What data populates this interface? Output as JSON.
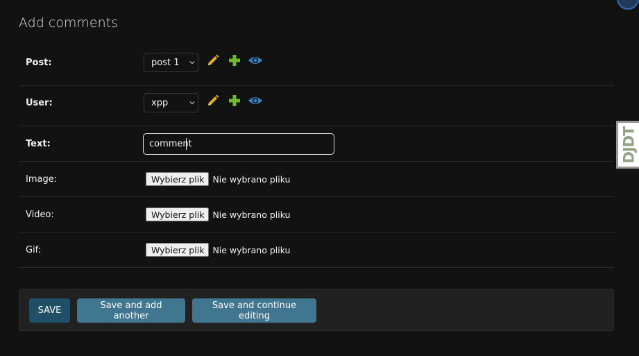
{
  "page": {
    "title": "Add comments"
  },
  "fields": {
    "post": {
      "label": "Post:",
      "selected": "post 1"
    },
    "user": {
      "label": "User:",
      "selected": "xpp"
    },
    "text": {
      "label": "Text:",
      "value": "comment"
    },
    "image": {
      "label": "Image:",
      "button": "Wybierz plik",
      "status": "Nie wybrano pliku"
    },
    "video": {
      "label": "Video:",
      "button": "Wybierz plik",
      "status": "Nie wybrano pliku"
    },
    "gif": {
      "label": "Gif:",
      "button": "Wybierz plik",
      "status": "Nie wybrano pliku"
    }
  },
  "related_icons": [
    "pencil-icon",
    "plus-icon",
    "eye-icon"
  ],
  "actions": {
    "save": "SAVE",
    "save_add_another": "Save and add another",
    "save_continue": "Save and continue editing"
  },
  "debug_toolbar": {
    "handle_text": "DJDT"
  },
  "colors": {
    "background": "#121212",
    "pencil": "#e0a82e",
    "plus": "#6fb82f",
    "eye": "#3a80c4",
    "save_button": "#205067",
    "secondary_button": "#417690"
  }
}
